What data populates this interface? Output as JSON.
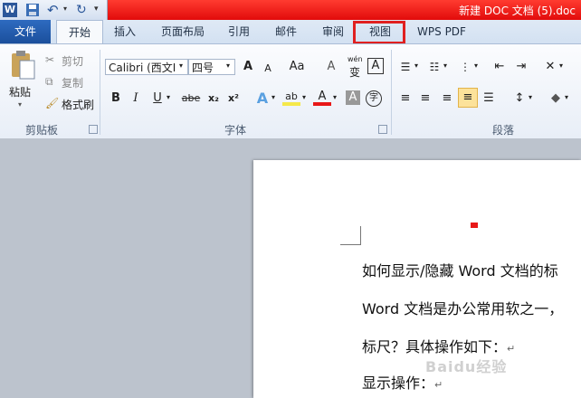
{
  "window": {
    "title": "新建 DOC 文档 (5).doc"
  },
  "qat": {
    "app_icon": "W",
    "undo": "↶",
    "redo": "↻"
  },
  "tabs": [
    "文件",
    "开始",
    "插入",
    "页面布局",
    "引用",
    "邮件",
    "审阅",
    "视图",
    "WPS PDF"
  ],
  "ribbon": {
    "clipboard": {
      "paste": "粘贴",
      "cut": "剪切",
      "copy": "复制",
      "format_painter": "格式刷",
      "label": "剪贴板"
    },
    "font": {
      "family": "Calibri (西文I",
      "size": "四号",
      "label": "字体",
      "grow": "A",
      "shrink": "A",
      "case": "Aa",
      "clear": "A",
      "pinyin_top": "wén",
      "pinyin": "变",
      "border_a": "A",
      "bold": "B",
      "italic": "I",
      "underline": "U",
      "strike": "abe",
      "sub": "x₂",
      "sup": "x²",
      "effects": "A",
      "highlight": "ab",
      "color": "A",
      "shade": "A",
      "circle": "字"
    },
    "paragraph": {
      "label": "段落"
    }
  },
  "document": {
    "lines": [
      "如何显示/隐藏 Word 文档的标",
      "Word 文档是办公常用软之一，",
      "标尺？具体操作如下：",
      "显示操作："
    ],
    "para_mark": "↵",
    "watermark": "Baidu经验"
  },
  "colors": {
    "title_red": "#e20b0b",
    "file_tab": "#1b4f9c",
    "highlight_box": "#e02020",
    "highlight_yellow": "#f5e84a",
    "font_red": "#e81818"
  }
}
